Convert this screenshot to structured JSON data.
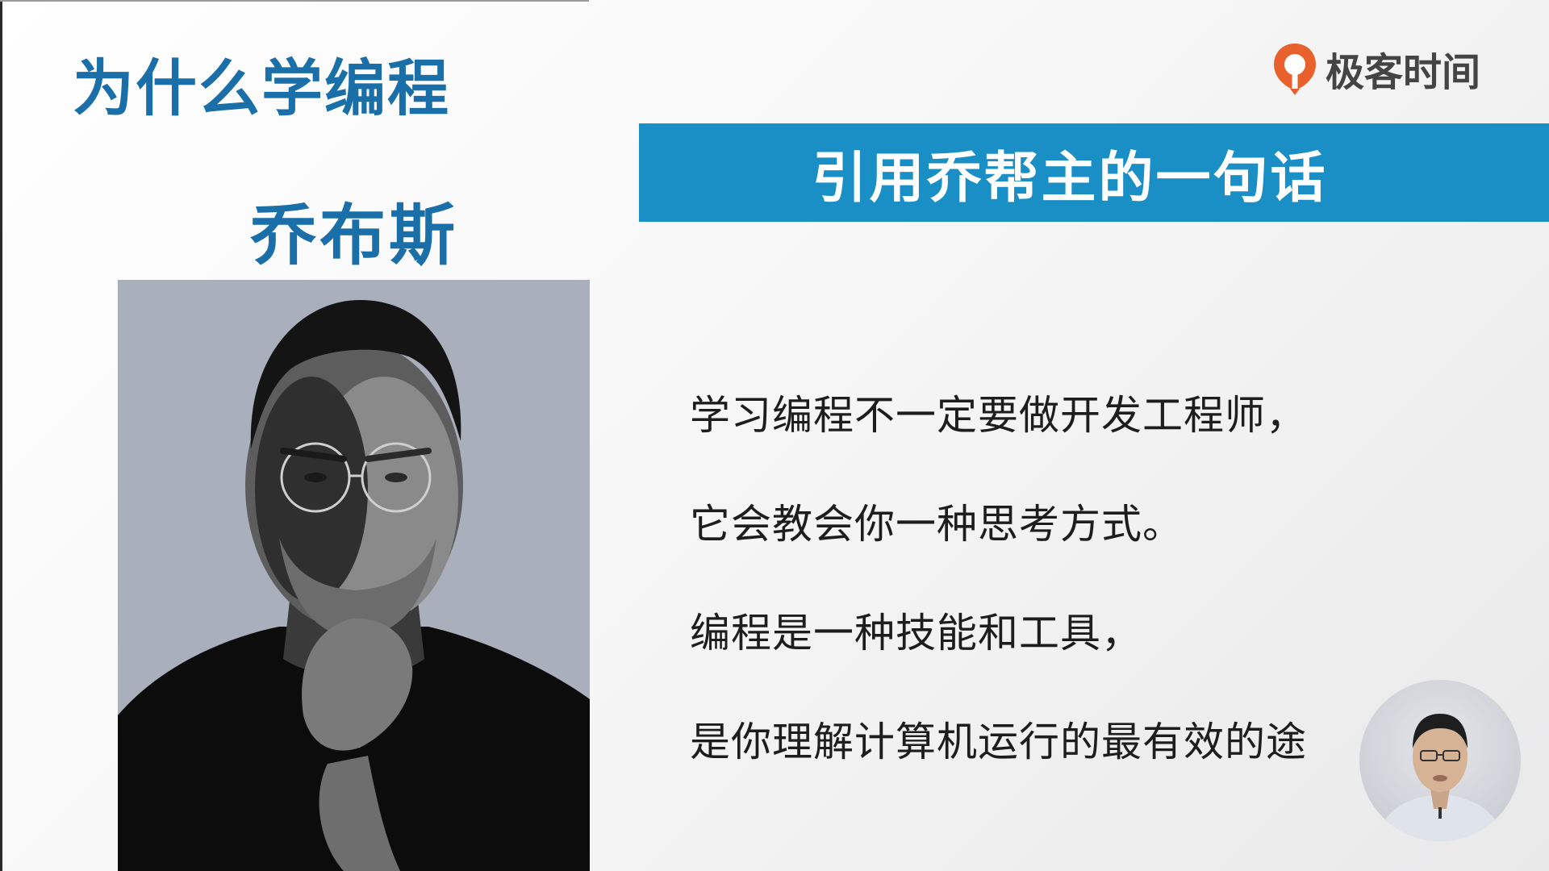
{
  "slide": {
    "title": "为什么学编程",
    "person_name": "乔布斯",
    "brand_logo_text": "极客时间",
    "quote_heading": "引用乔帮主的一句话",
    "quote_lines": [
      "学习编程不一定要做开发工程师，",
      "它会教会你一种思考方式。",
      "编程是一种技能和工具，",
      "是你理解计算机运行的最有效的途"
    ]
  },
  "colors": {
    "title_blue": "#1b6fa9",
    "banner_blue": "#1a8fc6",
    "logo_orange": "#e8612c"
  },
  "icons": {
    "logo": "geektime-logo-icon",
    "portrait": "person-portrait-image",
    "webcam": "presenter-webcam-icon"
  }
}
